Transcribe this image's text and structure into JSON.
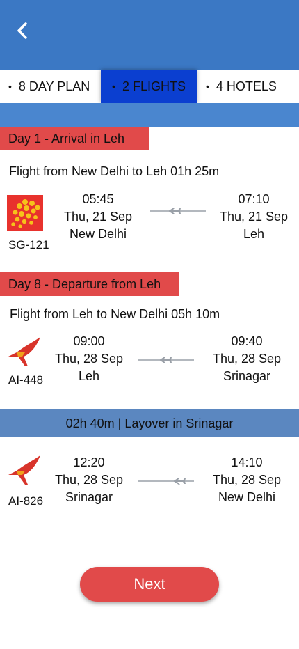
{
  "tabs": [
    {
      "label": "8 DAY PLAN"
    },
    {
      "label": "2 FLIGHTS"
    },
    {
      "label": "4 HOTELS"
    }
  ],
  "days": [
    {
      "tag": "Day 1 - Arrival in Leh",
      "route": "Flight from New Delhi to Leh 01h 25m",
      "segments": [
        {
          "code": "SG-121",
          "airline_icon": "spicejet-logo-icon",
          "dep_time": "05:45",
          "dep_date": "Thu, 21 Sep",
          "dep_city": "New Delhi",
          "arr_time": "07:10",
          "arr_date": "Thu, 21 Sep",
          "arr_city": "Leh"
        }
      ]
    },
    {
      "tag": "Day 8 - Departure from Leh",
      "route": "Flight from Leh to New Delhi 05h 10m",
      "segments": [
        {
          "code": "AI-448",
          "airline_icon": "air-india-logo-icon",
          "dep_time": "09:00",
          "dep_date": "Thu, 28 Sep",
          "dep_city": "Leh",
          "arr_time": "09:40",
          "arr_date": "Thu, 28 Sep",
          "arr_city": "Srinagar"
        },
        {
          "code": "AI-826",
          "airline_icon": "air-india-logo-icon",
          "dep_time": "12:20",
          "dep_date": "Thu, 28 Sep",
          "dep_city": "Srinagar",
          "arr_time": "14:10",
          "arr_date": "Thu, 28 Sep",
          "arr_city": "New Delhi"
        }
      ],
      "layover": "02h 40m | Layover in Srinagar"
    }
  ],
  "next_label": "Next",
  "colors": {
    "header": "#3b78c4",
    "active_tab": "#0b3fd0",
    "day_tag": "#e14a4a",
    "layover": "#5b87c0",
    "button": "#e14a4a"
  }
}
